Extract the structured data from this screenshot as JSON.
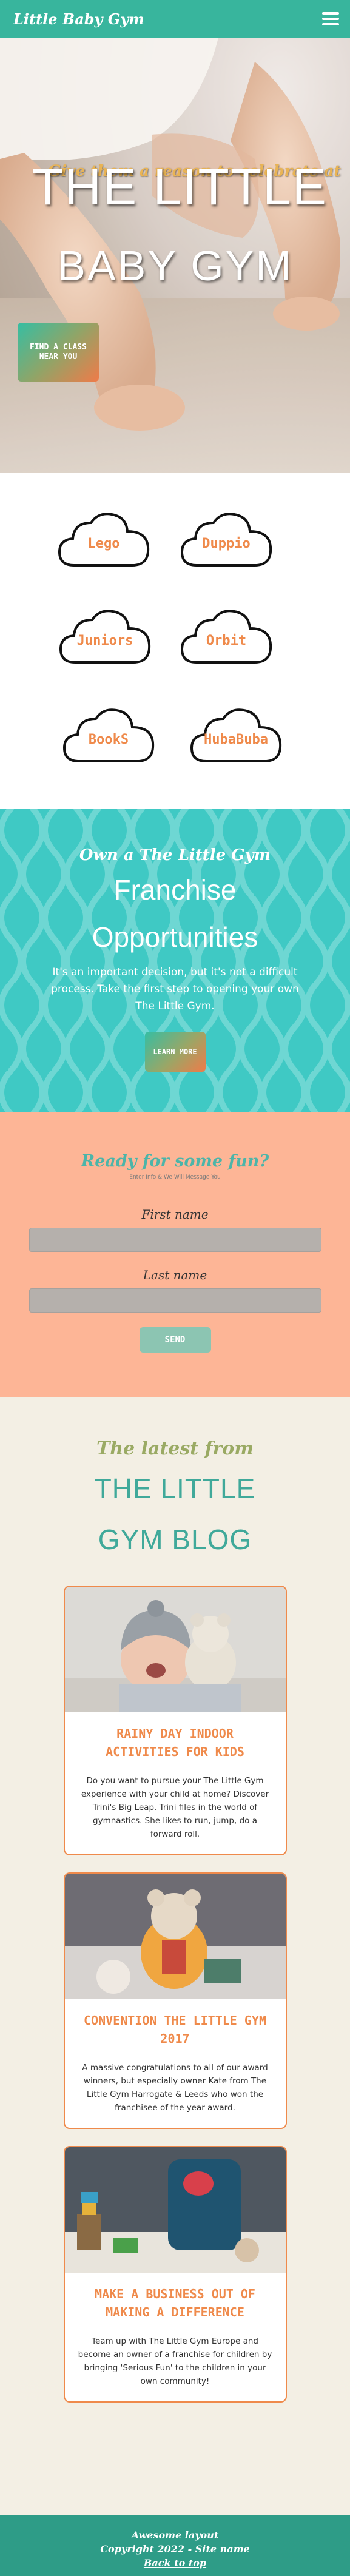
{
  "navbar": {
    "brand": "Little Baby Gym",
    "menu_icon": "hamburger-menu-icon"
  },
  "hero": {
    "tagline": "Give them a reason to celebrate at",
    "title_line1": "THE LITTLE",
    "title_line2": "BABY GYM",
    "cta": "FIND A CLASS NEAR YOU"
  },
  "programs": [
    "Lego",
    "Duppio",
    "Juniors",
    "Orbit",
    "BookS",
    "HubaBuba"
  ],
  "franchise": {
    "kicker": "Own a The Little Gym",
    "title_line1": "Franchise",
    "title_line2": "Opportunities",
    "description": "It's an important decision, but it's not a difficult process. Take the first step to opening your own The Little Gym.",
    "cta": "LEARN MORE"
  },
  "contact_form": {
    "title": "Ready for some fun?",
    "subtitle": "Enter Info & We Will Message You",
    "first_name_label": "First name",
    "last_name_label": "Last name",
    "submit": "SEND"
  },
  "blog": {
    "kicker": "The latest from",
    "title_line1": "THE LITTLE",
    "title_line2": "GYM BLOG",
    "posts": [
      {
        "title": "RAINY DAY INDOOR ACTIVITIES FOR KIDS",
        "text": "Do you want to pursue your The Little Gym experience with your child at home? Discover Trini's Big Leap. Trini files in the world of gymnastics. She likes to run, jump, do a forward roll."
      },
      {
        "title": "CONVENTION THE LITTLE GYM 2017",
        "text": "A massive congratulations to all of our award winners, but especially owner Kate from The Little Gym Harrogate & Leeds who won the franchisee of the year award."
      },
      {
        "title": "MAKE A BUSINESS OUT OF MAKING A DIFFERENCE",
        "text": "Team up with The Little Gym Europe and become an owner of a franchise for children by bringing 'Serious Fun' to the children in your own community!"
      }
    ]
  },
  "footer": {
    "line1": "Awesome layout",
    "line2": "Copyright 2022 - Site name",
    "back_to_top": "Back to top"
  },
  "colors": {
    "primary_green": "#38b59d",
    "accent_orange": "#ef8a4b",
    "hero_gold": "#e9b455",
    "franchise_teal": "#3fc9c4",
    "form_peach": "#fdb596",
    "blog_bg": "#f3efe4",
    "footer_green": "#2e9c87"
  }
}
